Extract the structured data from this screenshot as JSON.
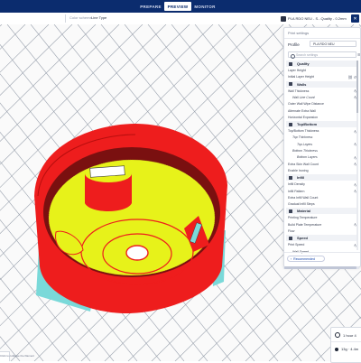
{
  "topbar": {
    "tabs": [
      {
        "label": "PREPARE",
        "active": false
      },
      {
        "label": "PREVIEW",
        "active": true
      },
      {
        "label": "MONITOR",
        "active": false
      }
    ]
  },
  "toolbar": {
    "color_scheme_label": "Color scheme",
    "color_scheme_value": "Line Type",
    "printer_summary": "PLA RDO NEU - S...Quality - 0.2mm",
    "settings_icon": "close-settings-icon"
  },
  "print_settings": {
    "title": "Print settings",
    "profile_label": "Profile",
    "profile_value": "PLA RDO NEU",
    "search_placeholder": "Search settings",
    "categories": [
      {
        "name": "Quality",
        "icon": "quality-icon",
        "settings": [
          {
            "label": "Layer Height",
            "indent": 0,
            "icon": ""
          },
          {
            "label": "Initial Layer Height",
            "indent": 0,
            "icon": "link-reset"
          }
        ]
      },
      {
        "name": "Walls",
        "icon": "walls-icon",
        "settings": [
          {
            "label": "Wall Thickness",
            "indent": 0,
            "icon": "fx"
          },
          {
            "label": "Wall Line Count",
            "indent": 1,
            "icon": "fx"
          },
          {
            "label": "Outer Wall Wipe Distance",
            "indent": 0,
            "icon": ""
          },
          {
            "label": "Alternate Extra Wall",
            "indent": 0,
            "icon": ""
          },
          {
            "label": "Horizontal Expansion",
            "indent": 0,
            "icon": ""
          }
        ]
      },
      {
        "name": "Top/Bottom",
        "icon": "topbottom-icon",
        "settings": [
          {
            "label": "Top/Bottom Thickness",
            "indent": 0,
            "icon": "fx"
          },
          {
            "label": "Top Thickness",
            "indent": 1,
            "icon": ""
          },
          {
            "label": "Top Layers",
            "indent": 2,
            "icon": "fx"
          },
          {
            "label": "Bottom Thickness",
            "indent": 1,
            "icon": ""
          },
          {
            "label": "Bottom Layers",
            "indent": 2,
            "icon": "fx"
          },
          {
            "label": "Extra Skin Wall Count",
            "indent": 0,
            "icon": "fx"
          },
          {
            "label": "Enable Ironing",
            "indent": 0,
            "icon": ""
          }
        ]
      },
      {
        "name": "Infill",
        "icon": "infill-icon",
        "settings": [
          {
            "label": "Infill Density",
            "indent": 0,
            "icon": "fx"
          },
          {
            "label": "Infill Pattern",
            "indent": 0,
            "icon": "fx"
          },
          {
            "label": "Extra Infill Wall Count",
            "indent": 0,
            "icon": ""
          },
          {
            "label": "Gradual Infill Steps",
            "indent": 0,
            "icon": ""
          }
        ]
      },
      {
        "name": "Material",
        "icon": "material-icon",
        "settings": [
          {
            "label": "Printing Temperature",
            "indent": 0,
            "icon": ""
          },
          {
            "label": "Build Plate Temperature",
            "indent": 0,
            "icon": "fx"
          },
          {
            "label": "Flow",
            "indent": 0,
            "icon": ""
          }
        ]
      },
      {
        "name": "Speed",
        "icon": "speed-icon",
        "settings": [
          {
            "label": "Print Speed",
            "indent": 0,
            "icon": "fx"
          },
          {
            "label": "Wall Speed",
            "indent": 1,
            "icon": ""
          }
        ]
      }
    ],
    "recommended_label": "Recommended"
  },
  "estimate": {
    "time": "1 hour 4",
    "material": "13g · 4.4m"
  },
  "corner_label": "Click to collapse the filament",
  "colors": {
    "topbar": "#0b2c6e",
    "wall_red": "#ee1d1d",
    "infill_yellow": "#e7f21a",
    "skin_cyan": "#7ad9d9",
    "grid": "#9aa2ae"
  }
}
